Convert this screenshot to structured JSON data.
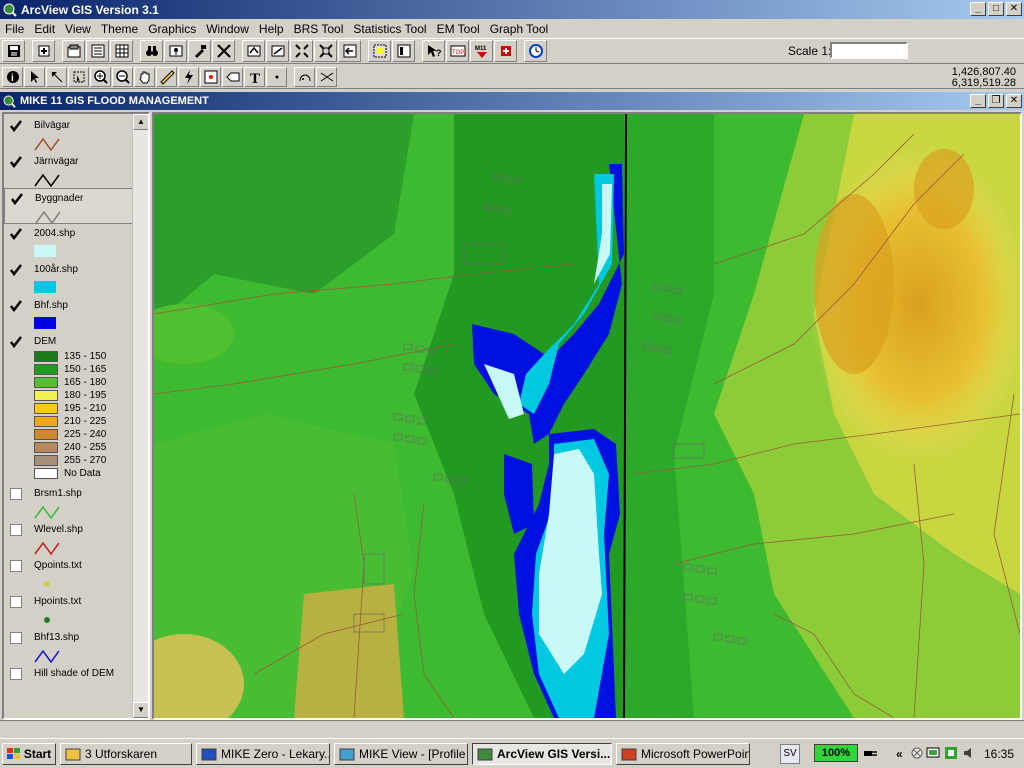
{
  "app": {
    "title": "ArcView GIS Version 3.1",
    "menus": [
      "File",
      "Edit",
      "View",
      "Theme",
      "Graphics",
      "Window",
      "Help",
      "BRS Tool",
      "Statistics Tool",
      "EM Tool",
      "Graph Tool"
    ],
    "scale_label": "Scale 1:",
    "scale_value": "",
    "coord_x": "1,426,807.40",
    "coord_y": "6,319,519.28"
  },
  "view": {
    "title": "MIKE 11 GIS FLOOD MANAGEMENT"
  },
  "legend": {
    "layers": [
      {
        "name": "Bilvägar",
        "checked": true,
        "symbol": "line",
        "color": "#a0522d"
      },
      {
        "name": "Järnvägar",
        "checked": true,
        "symbol": "line",
        "color": "#000000"
      },
      {
        "name": "Byggnader",
        "checked": true,
        "symbol": "line",
        "color": "#808080"
      },
      {
        "name": "2004.shp",
        "checked": true,
        "symbol": "fill",
        "color": "#c8f8f8"
      },
      {
        "name": "100år.shp",
        "checked": true,
        "symbol": "fill",
        "color": "#00c8e0"
      },
      {
        "name": "Bhf.shp",
        "checked": true,
        "symbol": "fill",
        "color": "#0000e0"
      },
      {
        "name": "DEM",
        "checked": true,
        "symbol": "ramp"
      },
      {
        "name": "Brsm1.shp",
        "checked": false,
        "symbol": "line",
        "color": "#38b838"
      },
      {
        "name": "Wlevel.shp",
        "checked": false,
        "symbol": "line",
        "color": "#c82020"
      },
      {
        "name": "Qpoints.txt",
        "checked": false,
        "symbol": "point",
        "color": "#d0d040"
      },
      {
        "name": "Hpoints.txt",
        "checked": false,
        "symbol": "point",
        "color": "#208020"
      },
      {
        "name": "Bhf13.shp",
        "checked": false,
        "symbol": "line",
        "color": "#1818c8"
      },
      {
        "name": "Hill shade of DEM",
        "checked": false,
        "symbol": "none"
      }
    ],
    "dem_classes": [
      {
        "label": "135 - 150",
        "color": "#1a7a1a"
      },
      {
        "label": "150 - 165",
        "color": "#229a22"
      },
      {
        "label": "165 - 180",
        "color": "#50c030"
      },
      {
        "label": "180 - 195",
        "color": "#f0f050"
      },
      {
        "label": "195 - 210",
        "color": "#f8c820"
      },
      {
        "label": "210 - 225",
        "color": "#f0a818"
      },
      {
        "label": "225 - 240",
        "color": "#d08830"
      },
      {
        "label": "240 - 255",
        "color": "#b88860"
      },
      {
        "label": "255 - 270",
        "color": "#a89078"
      },
      {
        "label": "No Data",
        "color": "#ffffff"
      }
    ]
  },
  "taskbar": {
    "start": "Start",
    "items": [
      {
        "label": "3 Utforskaren",
        "icon": "folder-icon",
        "active": false
      },
      {
        "label": "MIKE Zero - Lekary...",
        "icon": "mike-zero-icon",
        "active": false
      },
      {
        "label": "MIKE View - [Profile ...",
        "icon": "mike-view-icon",
        "active": false
      },
      {
        "label": "ArcView GIS Versi...",
        "icon": "arcview-icon",
        "active": true
      },
      {
        "label": "Microsoft PowerPoin...",
        "icon": "powerpoint-icon",
        "active": false
      }
    ],
    "lang": "SV",
    "battery": "100%",
    "clock": "16:35"
  }
}
